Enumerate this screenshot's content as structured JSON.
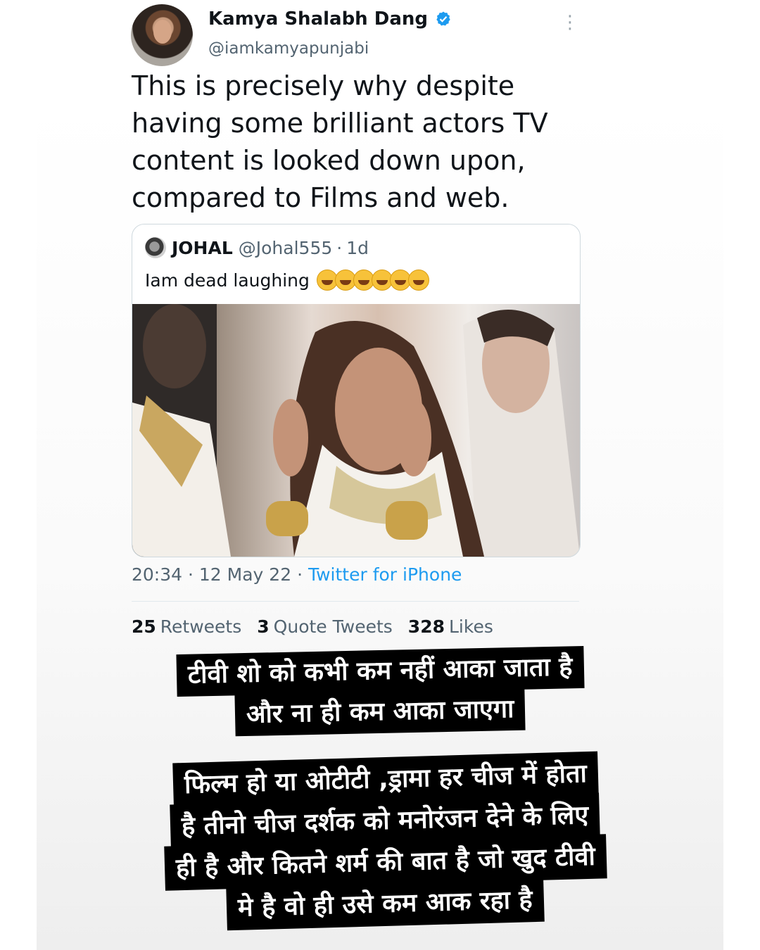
{
  "tweet": {
    "author_name": "Kamya Shalabh Dang",
    "author_handle": "@iamkamyapunjabi",
    "text_lines": [
      "This is precisely why despite",
      "having some brilliant actors TV",
      "content is looked down upon,",
      "compared to Films and web."
    ],
    "quoted": {
      "name": "JOHAL",
      "handle": "@Johal555",
      "separator": "·",
      "age": "1d",
      "text": "Iam dead laughing",
      "emoji_count": 6
    },
    "time": "20:34",
    "date": "12 May 22",
    "source": "Twitter for iPhone",
    "stats": {
      "retweets_count": "25",
      "retweets_label": "Retweets",
      "quotes_count": "3",
      "quotes_label": "Quote Tweets",
      "likes_count": "328",
      "likes_label": "Likes"
    }
  },
  "captions": {
    "first": [
      "टीवी शो को कभी कम नहीं आका जाता है",
      "और ना ही कम आका जाएगा"
    ],
    "second": [
      "फिल्म हो या ओटीटी ,ड्रामा हर चीज में होता",
      "है तीनो चीज दर्शक को मनोरंजन देने के लिए",
      "ही है और कितने शर्म की बात है जो खुद टीवी",
      "मे  है वो ही उसे कम आक रहा है"
    ]
  },
  "colors": {
    "link": "#1d9bf0",
    "secondary_text": "#536471",
    "caption_bg": "#000000"
  }
}
